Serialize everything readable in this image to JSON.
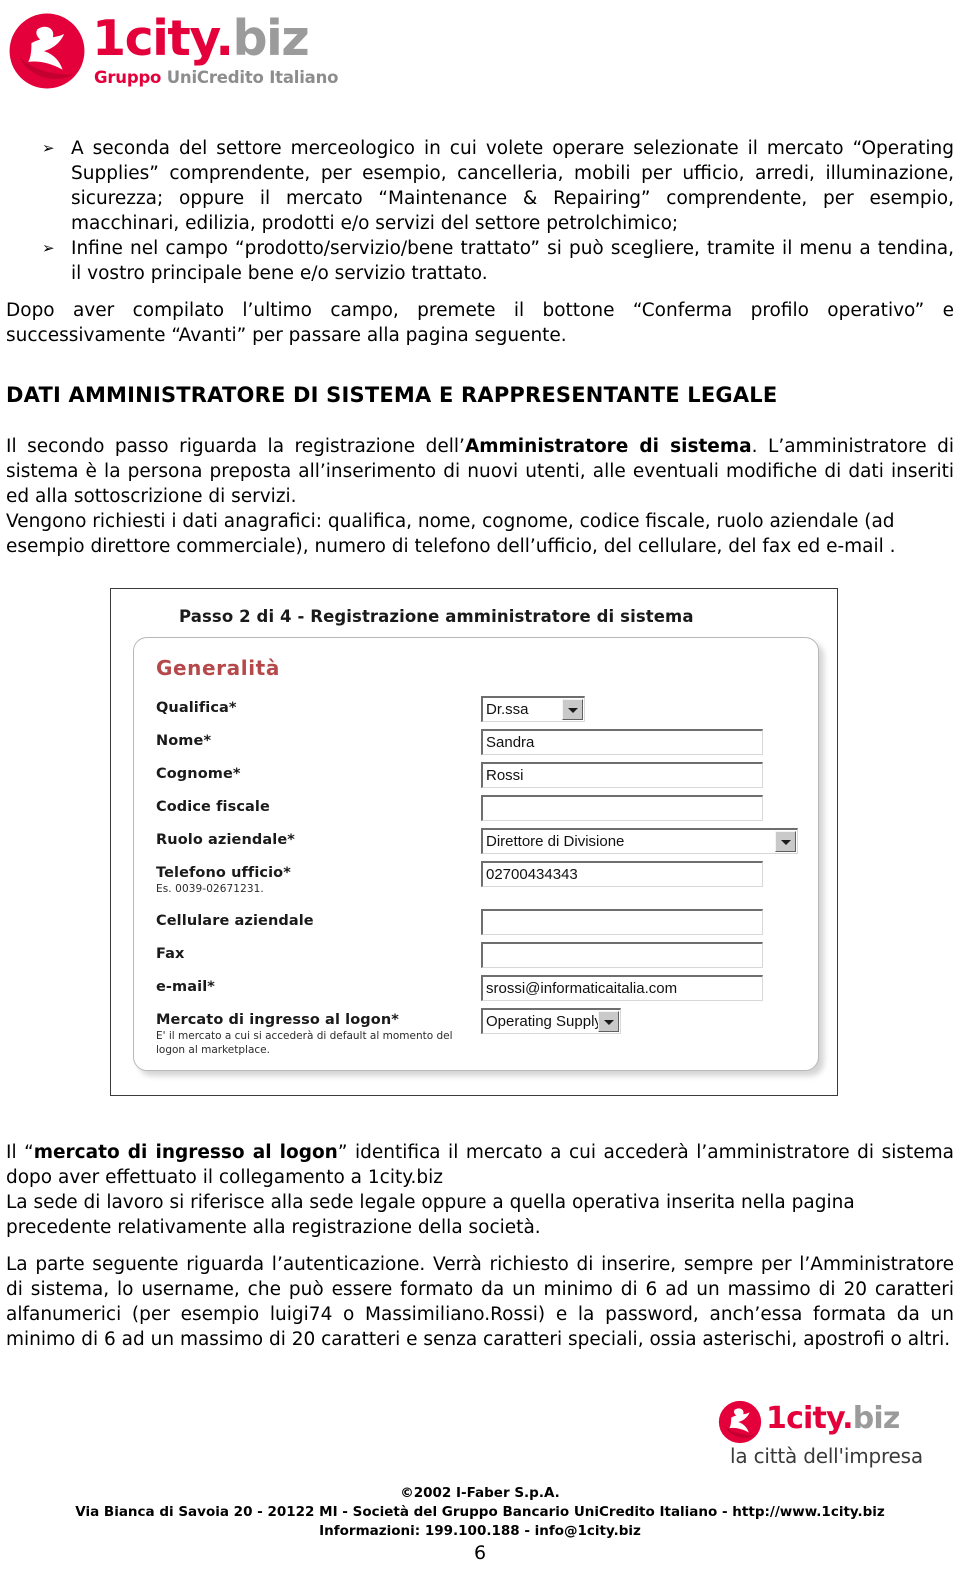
{
  "brand": {
    "wordmark_city": "1city",
    "wordmark_dot": ".",
    "wordmark_biz": "biz",
    "tagline_red": "Gruppo ",
    "tagline_gray": "UniCredito Italiano",
    "footer_tagline": "la città dell'impresa",
    "accent_red": "#e4003a",
    "accent_gray": "#9b9b9b",
    "section_red": "#b5484a"
  },
  "content": {
    "bullet_glyph": "➢",
    "bullets": [
      "A seconda del settore merceologico in cui volete operare selezionate il mercato “Operating Supplies” comprendente, per esempio, cancelleria, mobili per ufficio, arredi, illuminazione, sicurezza; oppure il mercato “Maintenance & Repairing” comprendente, per esempio, macchinari, edilizia, prodotti e/o servizi del settore petrolchimico;",
      "Infine nel campo “prodotto/servizio/bene trattato” si può scegliere, tramite il menu a tendina, il vostro principale bene e/o servizio trattato."
    ],
    "para_conferma": "Dopo aver compilato l’ultimo campo, premete il bottone “Conferma profilo operativo” e successivamente “Avanti” per passare alla pagina seguente.",
    "heading": "DATI AMMINISTRATORE DI SISTEMA E RAPPRESENTANTE LEGALE",
    "para_admin_1_a": "Il secondo passo riguarda la registrazione dell’",
    "para_admin_1_bold": "Amministratore di sistema",
    "para_admin_1_b": ". L’amministratore di sistema è la persona preposta all’inserimento di nuovi utenti, alle eventuali modifiche di dati inseriti ed alla sottoscrizione di servizi.",
    "para_admin_2": "Vengono richiesti i dati anagrafici: qualifica, nome, cognome, codice fiscale, ruolo aziendale (ad esempio direttore commerciale), numero di telefono dell’ufficio, del cellulare, del fax ed e-mail .",
    "para_mercato_a": "Il “",
    "para_mercato_bold": "mercato di ingresso al logon",
    "para_mercato_b": "” identifica il mercato a cui accederà l’amministratore di sistema dopo aver effettuato il collegamento a 1city.biz",
    "para_sede": "La sede di lavoro si riferisce alla sede legale oppure a quella operativa inserita nella pagina precedente relativamente alla registrazione della società.",
    "para_auth": "La parte seguente riguarda l’autenticazione. Verrà richiesto di inserire, sempre per l’Amministratore di sistema, lo username, che può essere formato da un minimo di 6 ad un massimo di 20 caratteri alfanumerici (per esempio luigi74 o Massimiliano.Rossi) e la password, anch’essa formata da un minimo di 6 ad un massimo di 20 caratteri e senza caratteri speciali, ossia asterischi, apostrofi o altri."
  },
  "screenshot": {
    "title": "Passo 2 di 4 - Registrazione amministratore di sistema",
    "section_title": "Generalità",
    "fields": [
      {
        "label": "Qualifica*",
        "type": "select",
        "value": "Dr.ssa"
      },
      {
        "label": "Nome*",
        "type": "text",
        "value": "Sandra"
      },
      {
        "label": "Cognome*",
        "type": "text",
        "value": "Rossi"
      },
      {
        "label": "Codice fiscale",
        "type": "text",
        "value": ""
      },
      {
        "label": "Ruolo aziendale*",
        "type": "select",
        "value": "Direttore di Divisione"
      },
      {
        "label": "Telefono ufficio*",
        "type": "text",
        "value": "02700434343",
        "hint": "Es. 0039-02671231."
      },
      {
        "label": "Cellulare aziendale",
        "type": "text",
        "value": ""
      },
      {
        "label": "Fax",
        "type": "text",
        "value": ""
      },
      {
        "label": "e-mail*",
        "type": "text",
        "value": "srossi@informaticaitalia.com"
      },
      {
        "label": "Mercato di ingresso al logon*",
        "type": "select",
        "value": "Operating Supply",
        "hint": "E' il mercato a cui si accederà di default al momento del logon al marketplace."
      }
    ]
  },
  "footer": {
    "copyright": "©2002 I-Faber S.p.A.",
    "address": "Via Bianca di Savoia 20 - 20122 MI  - Società del Gruppo Bancario UniCredito Italiano - http://www.1city.biz",
    "info": "Informazioni: 199.100.188 - info@1city.biz",
    "page_number": "6"
  }
}
